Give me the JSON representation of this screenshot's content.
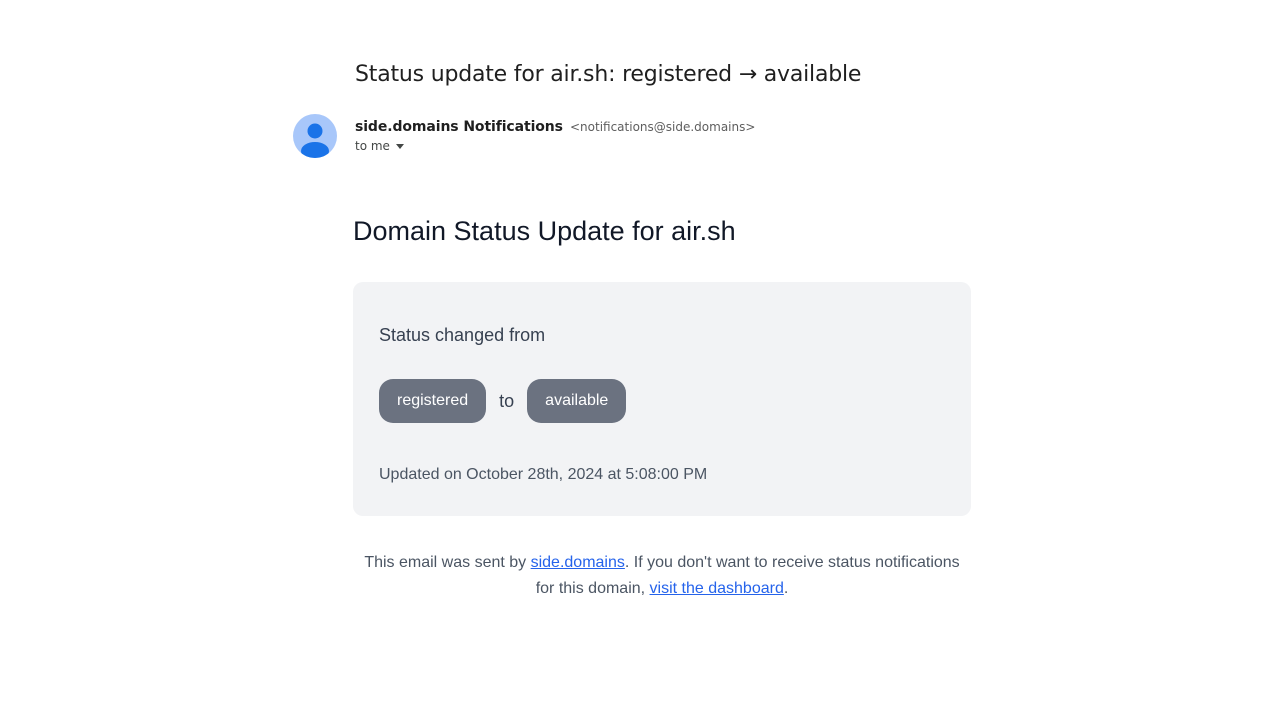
{
  "email": {
    "subject": "Status update for air.sh: registered → available",
    "sender_name": "side.domains Notifications",
    "sender_email": "<notifications@side.domains>",
    "recipient": "to me",
    "avatar_icon": "person-icon"
  },
  "body": {
    "heading": "Domain Status Update for air.sh",
    "changed_label": "Status changed from",
    "from_status": "registered",
    "to_word": "to",
    "to_status": "available",
    "updated": "Updated on October 28th, 2024 at 5:08:00 PM"
  },
  "footer": {
    "text_1": "This email was sent by ",
    "link_1": "side.domains",
    "text_2": ". If you don't want to receive status notifications for this domain, ",
    "link_2": "visit the dashboard",
    "text_3": "."
  },
  "colors": {
    "pill_bg": "#6b7280",
    "card_bg": "#f2f3f5",
    "link": "#2563eb",
    "avatar_bg": "#a8c7fa",
    "avatar_fg": "#1a73e8"
  }
}
